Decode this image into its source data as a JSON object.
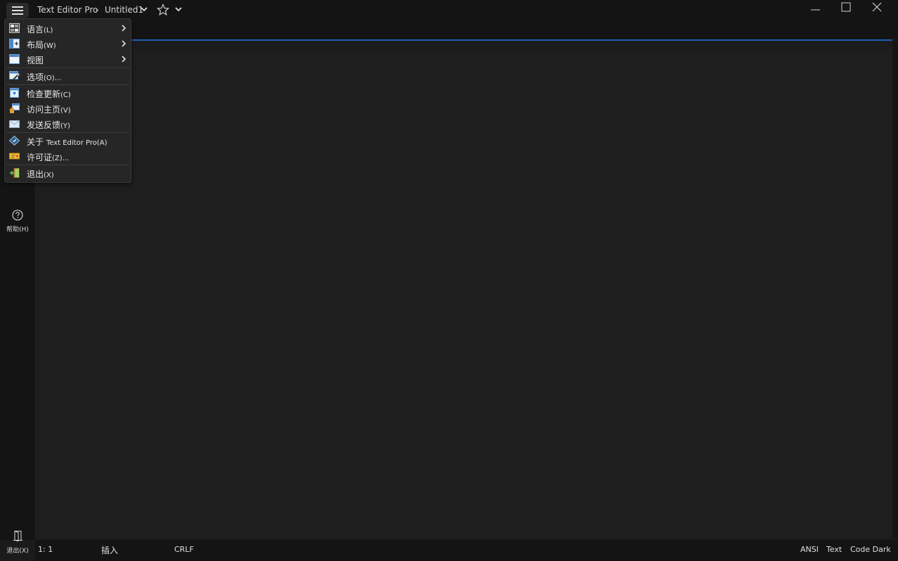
{
  "titlebar": {
    "app_name": "Text Editor Pro",
    "separator": "-",
    "document_name": "Untitled1"
  },
  "menu": {
    "items": [
      {
        "label": "语言",
        "accel": "(L)",
        "icon": "language-icon",
        "has_submenu": true
      },
      {
        "label": "布局",
        "accel": "(W)",
        "icon": "layout-icon",
        "has_submenu": true
      },
      {
        "label": "视图",
        "accel": "",
        "icon": "view-icon",
        "has_submenu": true
      },
      {
        "label": "选项",
        "accel": "(O)...",
        "icon": "options-icon",
        "has_submenu": false
      },
      {
        "label": "检查更新",
        "accel": "(C)",
        "icon": "check-updates-icon",
        "has_submenu": false
      },
      {
        "label": "访问主页",
        "accel": "(V)",
        "icon": "homepage-icon",
        "has_submenu": false
      },
      {
        "label": "发送反馈",
        "accel": "(Y)",
        "icon": "feedback-mail-icon",
        "has_submenu": false
      },
      {
        "label": "关于 ",
        "accel": "Text Editor Pro(A)",
        "icon": "about-icon",
        "has_submenu": false
      },
      {
        "label": "许可证",
        "accel": "(Z)...",
        "icon": "license-icon",
        "has_submenu": false
      },
      {
        "label": "退出",
        "accel": "(X)",
        "icon": "exit-icon",
        "has_submenu": false
      }
    ]
  },
  "left_toolbar": {
    "help_label": "帮助(H)",
    "exit_label": "退出(X)"
  },
  "statusbar": {
    "position": "1: 1",
    "mode": "插入",
    "line_ending": "CRLF",
    "encoding": "ANSI",
    "syntax": "Text",
    "theme": "Code Dark"
  },
  "colors": {
    "accent": "#1e5fb3",
    "background": "#1b1b1b",
    "menu_background": "#262626"
  }
}
